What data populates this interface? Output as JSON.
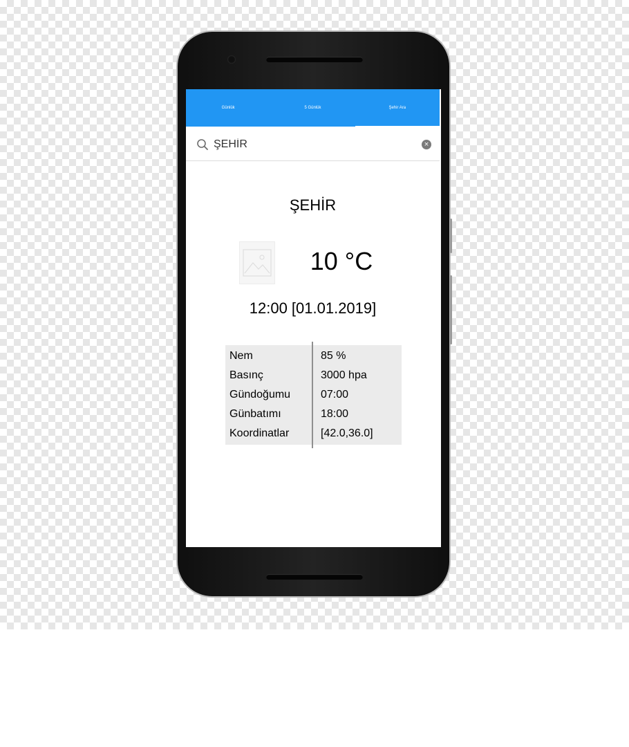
{
  "tabs": [
    {
      "label": "Günlük"
    },
    {
      "label": "5 Günlük"
    },
    {
      "label": "Şehir Ara"
    }
  ],
  "search": {
    "value": "ŞEHİR",
    "placeholder": "ŞEHİR",
    "clear_glyph": "×"
  },
  "weather": {
    "city": "ŞEHİR",
    "temperature": "10 °C",
    "datetime": "12:00 [01.01.2019]",
    "icon": "image-placeholder-icon"
  },
  "details": [
    {
      "label": "Nem",
      "value": "85 %"
    },
    {
      "label": "Basınç",
      "value": "3000 hpa"
    },
    {
      "label": "Gündoğumu",
      "value": "07:00"
    },
    {
      "label": "Günbatımı",
      "value": "18:00"
    },
    {
      "label": "Koordinatlar",
      "value": "[42.0,36.0]"
    }
  ],
  "colors": {
    "accent": "#2196f3",
    "table_bg": "#ebebeb"
  }
}
